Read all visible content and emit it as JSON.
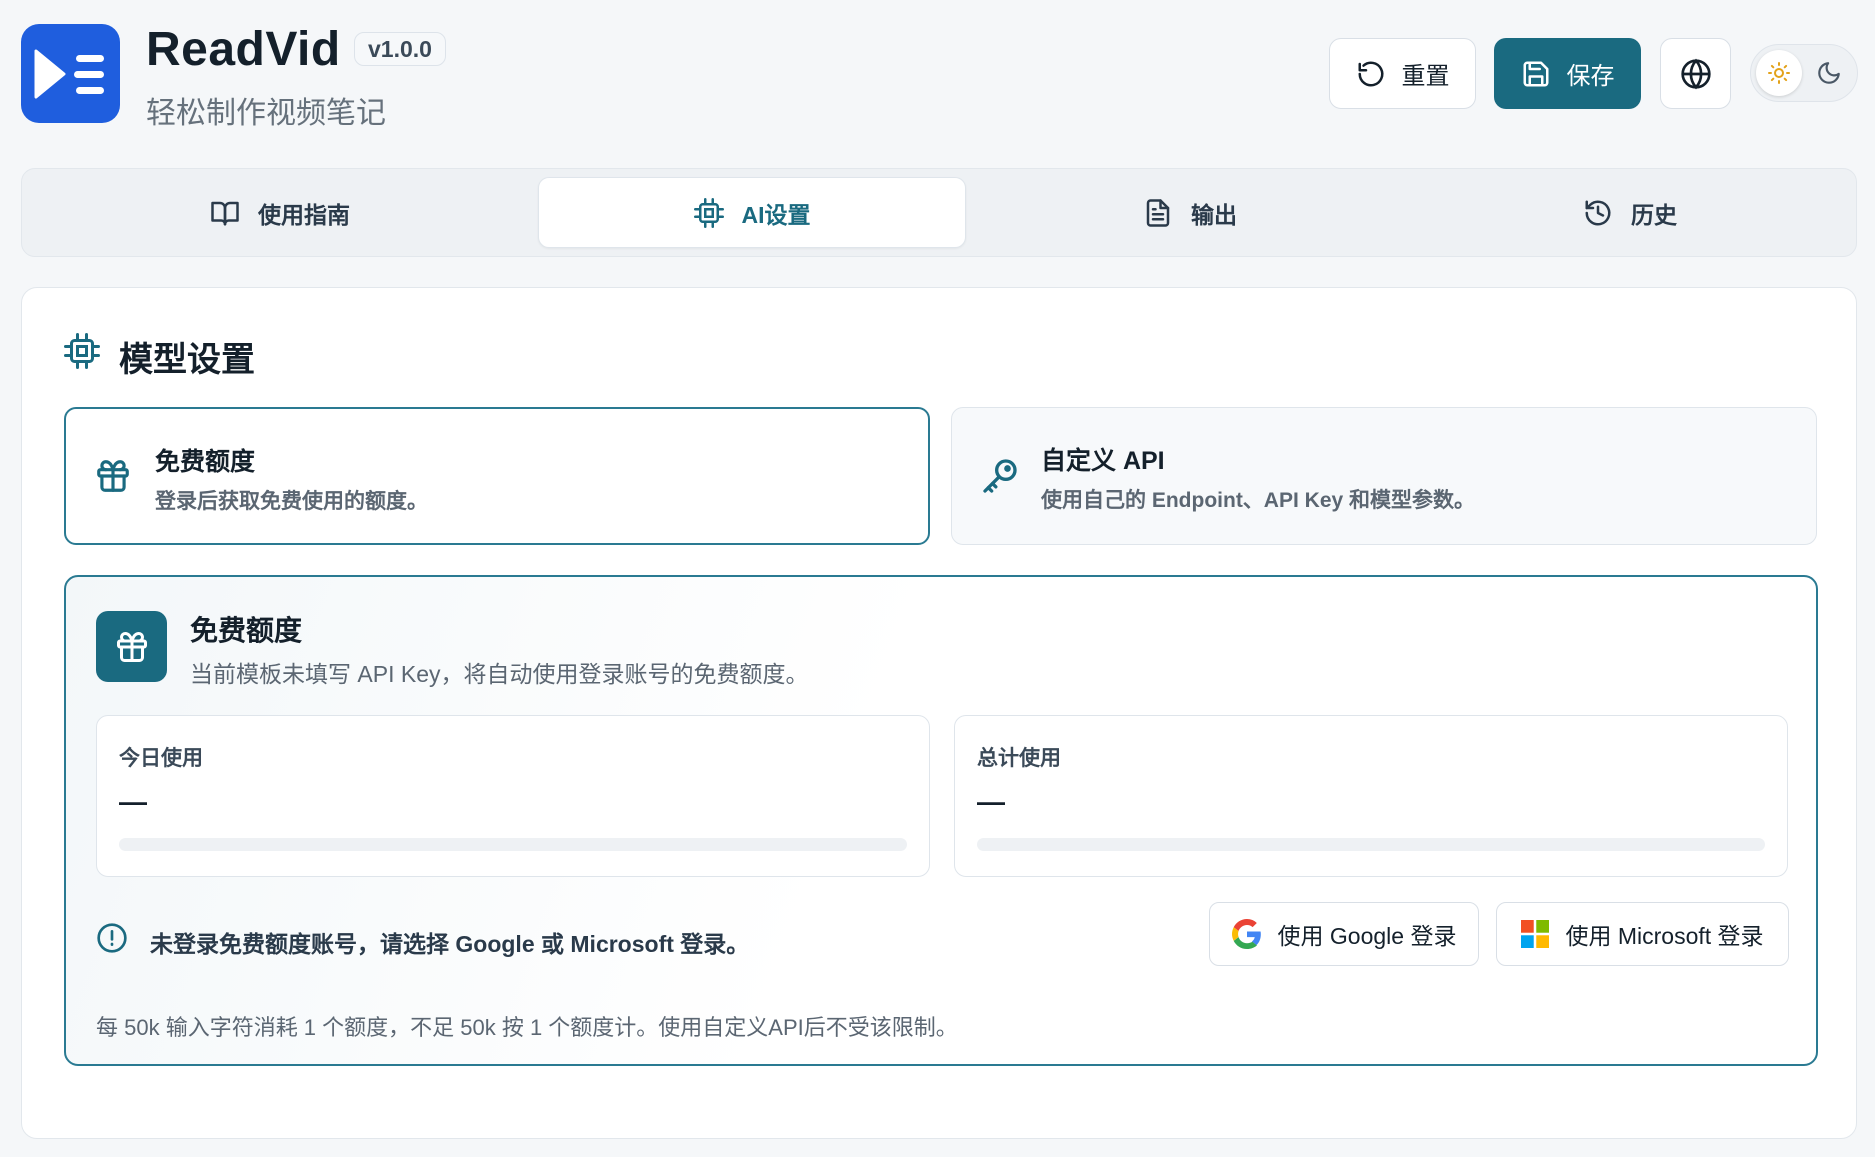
{
  "app": {
    "name": "ReadVid",
    "version": "v1.0.0",
    "subtitle": "轻松制作视频笔记"
  },
  "header": {
    "reset_label": "重置",
    "save_label": "保存",
    "language_icon": "globe-icon",
    "theme": {
      "active": "light",
      "light_icon": "sun-icon",
      "dark_icon": "moon-icon"
    }
  },
  "tabs": [
    {
      "label": "使用指南",
      "icon": "book-icon",
      "active": false
    },
    {
      "label": "AI设置",
      "icon": "cpu-icon",
      "active": true
    },
    {
      "label": "输出",
      "icon": "document-icon",
      "active": false
    },
    {
      "label": "历史",
      "icon": "history-icon",
      "active": false
    }
  ],
  "section": {
    "title": "模型设置",
    "options": [
      {
        "title": "免费额度",
        "description": "登录后获取免费使用的额度。",
        "icon": "gift-icon",
        "selected": true
      },
      {
        "title": "自定义 API",
        "description": "使用自己的 Endpoint、API Key 和模型参数。",
        "icon": "key-icon",
        "selected": false
      }
    ]
  },
  "quota": {
    "title": "免费额度",
    "description": "当前模板未填写 API Key，将自动使用登录账号的免费额度。",
    "today": {
      "label": "今日使用",
      "value": "—",
      "progress": 0
    },
    "total": {
      "label": "总计使用",
      "value": "—",
      "progress": 0
    },
    "alert": "未登录免费额度账号，请选择 Google 或 Microsoft 登录。",
    "google_label": "使用 Google 登录",
    "microsoft_label": "使用 Microsoft 登录",
    "footnote": "每 50k 输入字符消耗 1 个额度，不足 50k 按 1 个额度计。使用自定义API后不受该限制。"
  },
  "colors": {
    "accent": "#1a6a80",
    "logo": "#1f5ede",
    "background": "#f5f7f9"
  }
}
